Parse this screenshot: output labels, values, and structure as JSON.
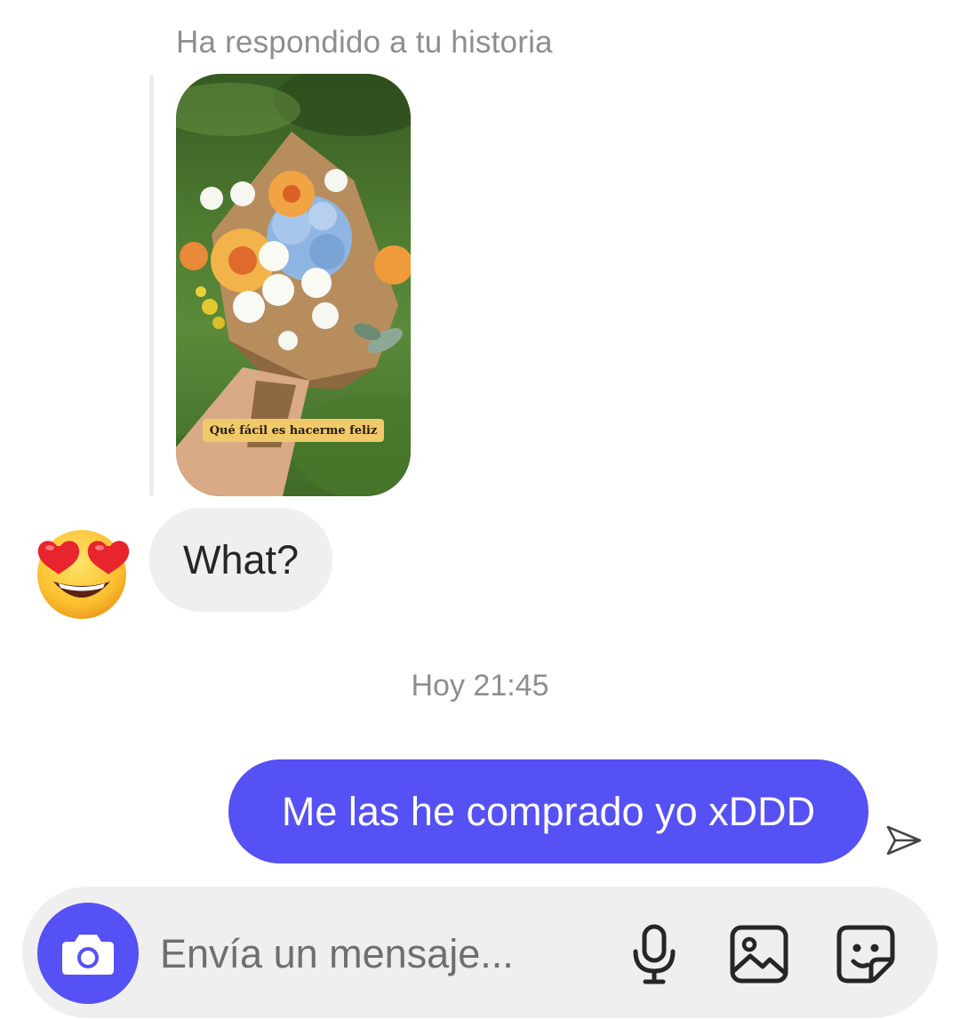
{
  "story_reply": {
    "caption": "Ha respondido a tu historia",
    "story_text": "Qué fácil es hacerme feliz"
  },
  "received": {
    "reaction_icon": "heart-eyes-emoji",
    "message": "What?"
  },
  "timestamp": "Hoy 21:45",
  "sent": {
    "message": "Me las he comprado yo xDDD",
    "status_icon": "sent-arrow-icon"
  },
  "composer": {
    "placeholder": "Envía un mensaje...",
    "value": "",
    "icons": [
      "camera-icon",
      "microphone-icon",
      "gallery-icon",
      "sticker-icon"
    ]
  },
  "colors": {
    "accent": "#5551f4",
    "bubble_in": "#efefef",
    "muted_text": "#8e8e8e"
  }
}
